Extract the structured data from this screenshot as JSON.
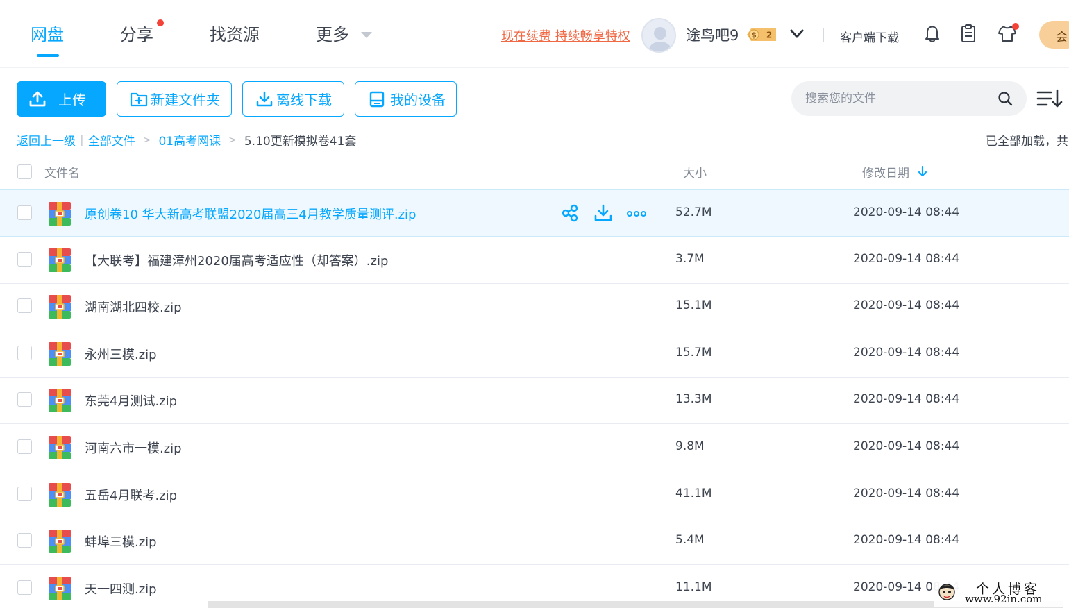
{
  "colors": {
    "accent": "#06a7ff",
    "promo": "#f06844",
    "text": "#3d4450",
    "row_hover": "#eef8fe",
    "notify_dot": "#f44336"
  },
  "nav": {
    "tabs": [
      {
        "label": "网盘",
        "active": true
      },
      {
        "label": "分享",
        "has_dot": true
      },
      {
        "label": "找资源"
      },
      {
        "label": "更多",
        "has_caret": true
      }
    ],
    "promo_link": "现在续费 持续畅享特权",
    "username": "途鸟吧9",
    "vip_level": "2",
    "client_download": "客户端下载",
    "icons": [
      "bell-icon",
      "clipboard-icon",
      "shirt-icon"
    ],
    "member_button": "会"
  },
  "toolbar": {
    "upload": "上传",
    "new_folder": "新建文件夹",
    "offline_download": "离线下载",
    "my_devices": "我的设备",
    "search_placeholder": "搜索您的文件"
  },
  "breadcrumb": {
    "back": "返回上一级",
    "items": [
      "全部文件",
      "01高考网课"
    ],
    "current": "5.10更新模拟卷41套"
  },
  "status": {
    "loaded": "已全部加载，共"
  },
  "table": {
    "headers": {
      "name": "文件名",
      "size": "大小",
      "date": "修改日期"
    },
    "sort_icon": "arrow-down-icon",
    "rows": [
      {
        "name": "原创卷10 华大新高考联盟2020届高三4月教学质量测评.zip",
        "size": "52.7M",
        "date": "2020-09-14 08:44",
        "hovered": true
      },
      {
        "name": "【大联考】福建漳州2020届高考适应性（却答案）.zip",
        "size": "3.7M",
        "date": "2020-09-14 08:44"
      },
      {
        "name": "湖南湖北四校.zip",
        "size": "15.1M",
        "date": "2020-09-14 08:44"
      },
      {
        "name": "永州三模.zip",
        "size": "15.7M",
        "date": "2020-09-14 08:44"
      },
      {
        "name": "东莞4月测试.zip",
        "size": "13.3M",
        "date": "2020-09-14 08:44"
      },
      {
        "name": "河南六市一模.zip",
        "size": "9.8M",
        "date": "2020-09-14 08:44"
      },
      {
        "name": "五岳4月联考.zip",
        "size": "41.1M",
        "date": "2020-09-14 08:44"
      },
      {
        "name": "蚌埠三模.zip",
        "size": "5.4M",
        "date": "2020-09-14 08:44"
      },
      {
        "name": "天一四测.zip",
        "size": "11.1M",
        "date": "2020-09-14 08:44"
      }
    ]
  },
  "watermark": {
    "title": "个人博客",
    "url": "www.92in.com"
  }
}
